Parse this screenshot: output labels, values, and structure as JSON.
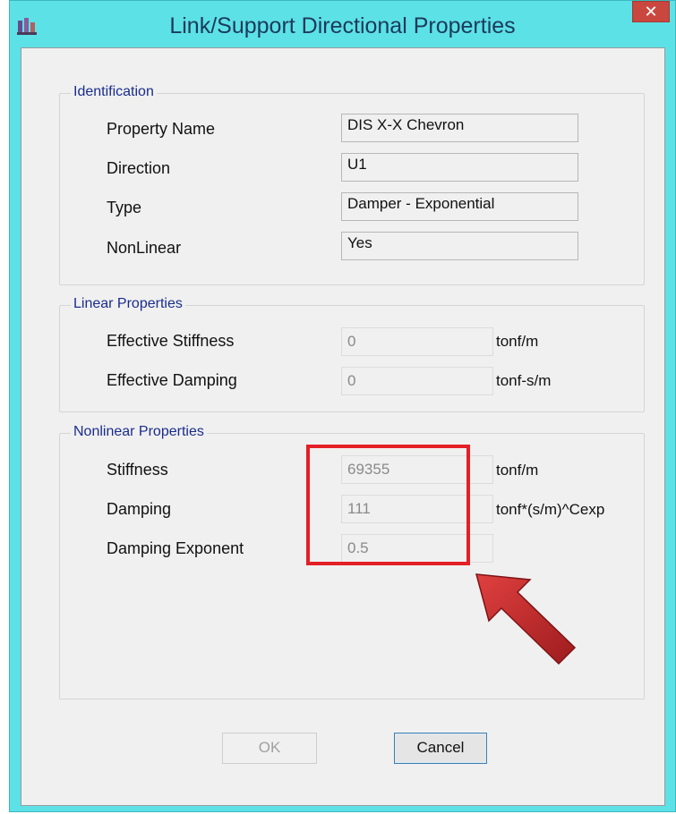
{
  "window": {
    "title": "Link/Support Directional Properties",
    "close_label": "✕"
  },
  "identification": {
    "title": "Identification",
    "rows": [
      {
        "label": "Property Name",
        "value": "DIS X-X Chevron"
      },
      {
        "label": "Direction",
        "value": "U1"
      },
      {
        "label": "Type",
        "value": "Damper - Exponential"
      },
      {
        "label": "NonLinear",
        "value": "Yes"
      }
    ]
  },
  "linear": {
    "title": "Linear Properties",
    "rows": [
      {
        "label": "Effective Stiffness",
        "value": "0",
        "unit": "tonf/m"
      },
      {
        "label": "Effective Damping",
        "value": "0",
        "unit": "tonf-s/m"
      }
    ]
  },
  "nonlinear": {
    "title": "Nonlinear Properties",
    "rows": [
      {
        "label": "Stiffness",
        "value": "69355",
        "unit": "tonf/m"
      },
      {
        "label": "Damping",
        "value": "111",
        "unit": "tonf*(s/m)^Cexp"
      },
      {
        "label": "Damping Exponent",
        "value": "0.5",
        "unit": ""
      }
    ]
  },
  "buttons": {
    "ok": "OK",
    "cancel": "Cancel"
  },
  "colors": {
    "title_bar": "#5ce1e6",
    "highlight": "#e41f26",
    "arrow": "#c0282b"
  }
}
